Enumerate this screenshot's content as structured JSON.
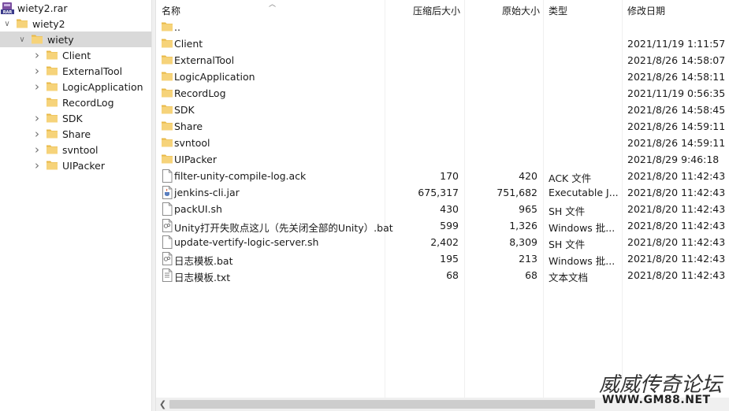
{
  "tree": {
    "archive": "wiety2.rar",
    "archive_icon": "rar-archive-icon",
    "nodes": [
      {
        "label": "wiety2",
        "depth": 1,
        "expanded": true,
        "has_children": true,
        "selected": false
      },
      {
        "label": "wiety",
        "depth": 2,
        "expanded": true,
        "has_children": true,
        "selected": true
      },
      {
        "label": "Client",
        "depth": 3,
        "expanded": false,
        "has_children": true,
        "selected": false
      },
      {
        "label": "ExternalTool",
        "depth": 3,
        "expanded": false,
        "has_children": true,
        "selected": false
      },
      {
        "label": "LogicApplication",
        "depth": 3,
        "expanded": false,
        "has_children": true,
        "selected": false
      },
      {
        "label": "RecordLog",
        "depth": 3,
        "expanded": false,
        "has_children": false,
        "selected": false
      },
      {
        "label": "SDK",
        "depth": 3,
        "expanded": false,
        "has_children": true,
        "selected": false
      },
      {
        "label": "Share",
        "depth": 3,
        "expanded": false,
        "has_children": true,
        "selected": false
      },
      {
        "label": "svntool",
        "depth": 3,
        "expanded": false,
        "has_children": true,
        "selected": false
      },
      {
        "label": "UIPacker",
        "depth": 3,
        "expanded": false,
        "has_children": true,
        "selected": false
      }
    ]
  },
  "columns": {
    "name": "名称",
    "packed": "压缩后大小",
    "original": "原始大小",
    "type": "类型",
    "modified": "修改日期"
  },
  "files": [
    {
      "name": "..",
      "packed": "",
      "original": "",
      "type": "",
      "modified": "",
      "icon": "folder-icon"
    },
    {
      "name": "Client",
      "packed": "",
      "original": "",
      "type": "",
      "modified": "2021/11/19 1:11:57",
      "icon": "folder-icon"
    },
    {
      "name": "ExternalTool",
      "packed": "",
      "original": "",
      "type": "",
      "modified": "2021/8/26 14:58:07",
      "icon": "folder-icon"
    },
    {
      "name": "LogicApplication",
      "packed": "",
      "original": "",
      "type": "",
      "modified": "2021/8/26 14:58:11",
      "icon": "folder-icon"
    },
    {
      "name": "RecordLog",
      "packed": "",
      "original": "",
      "type": "",
      "modified": "2021/11/19 0:56:35",
      "icon": "folder-icon"
    },
    {
      "name": "SDK",
      "packed": "",
      "original": "",
      "type": "",
      "modified": "2021/8/26 14:58:45",
      "icon": "folder-icon"
    },
    {
      "name": "Share",
      "packed": "",
      "original": "",
      "type": "",
      "modified": "2021/8/26 14:59:11",
      "icon": "folder-icon"
    },
    {
      "name": "svntool",
      "packed": "",
      "original": "",
      "type": "",
      "modified": "2021/8/26 14:59:11",
      "icon": "folder-icon"
    },
    {
      "name": "UIPacker",
      "packed": "",
      "original": "",
      "type": "",
      "modified": "2021/8/29 9:46:18",
      "icon": "folder-icon"
    },
    {
      "name": "filter-unity-compile-log.ack",
      "packed": "170",
      "original": "420",
      "type": "ACK 文件",
      "modified": "2021/8/20 11:42:43",
      "icon": "file-icon"
    },
    {
      "name": "jenkins-cli.jar",
      "packed": "675,317",
      "original": "751,682",
      "type": "Executable J...",
      "modified": "2021/8/20 11:42:43",
      "icon": "jar-file-icon"
    },
    {
      "name": "packUI.sh",
      "packed": "430",
      "original": "965",
      "type": "SH 文件",
      "modified": "2021/8/20 11:42:43",
      "icon": "file-icon"
    },
    {
      "name": "Unity打开失败点这儿（先关闭全部的Unity）.bat",
      "packed": "599",
      "original": "1,326",
      "type": "Windows 批...",
      "modified": "2021/8/20 11:42:43",
      "icon": "batch-file-icon"
    },
    {
      "name": "update-vertify-logic-server.sh",
      "packed": "2,402",
      "original": "8,309",
      "type": "SH 文件",
      "modified": "2021/8/20 11:42:43",
      "icon": "file-icon"
    },
    {
      "name": "日志模板.bat",
      "packed": "195",
      "original": "213",
      "type": "Windows 批...",
      "modified": "2021/8/20 11:42:43",
      "icon": "batch-file-icon"
    },
    {
      "name": "日志模板.txt",
      "packed": "68",
      "original": "68",
      "type": "文本文档",
      "modified": "2021/8/20 11:42:43",
      "icon": "text-file-icon"
    }
  ],
  "watermark": {
    "line1": "威威传奇论坛",
    "line2": "WWW.GM88.NET"
  },
  "colors": {
    "folder": "#f6d37a",
    "selection": "#d9d9d9",
    "scroll_thumb": "#cdcdcd"
  }
}
